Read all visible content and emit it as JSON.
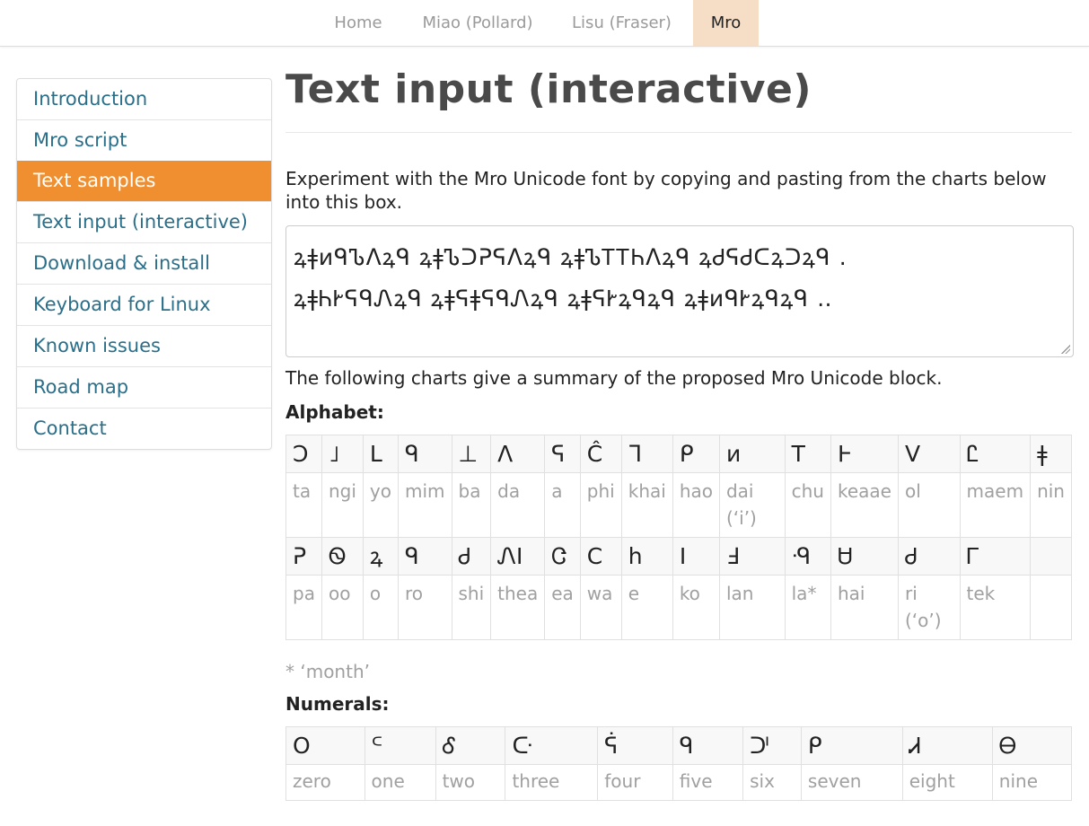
{
  "nav": {
    "tabs": [
      {
        "label": "Home"
      },
      {
        "label": "Miao (Pollard)"
      },
      {
        "label": "Lisu (Fraser)"
      },
      {
        "label": "Mro"
      }
    ],
    "active": "Mro",
    "active_color": "#f5dec5"
  },
  "sidebar": {
    "items": [
      {
        "label": "Introduction"
      },
      {
        "label": "Mro script"
      },
      {
        "label": "Text samples"
      },
      {
        "label": "Text input (interactive)"
      },
      {
        "label": "Download & install"
      },
      {
        "label": "Keyboard for Linux"
      },
      {
        "label": "Known issues"
      },
      {
        "label": "Road map"
      },
      {
        "label": "Contact"
      }
    ],
    "active": "Text samples",
    "active_color": "#ef8f30",
    "link_color": "#2a6f8a"
  },
  "main": {
    "title": "Text input (interactive)",
    "intro": "Experiment with the Mro Unicode font by copying and pasting from the charts below into this box.",
    "textbox_lines": [
      "ꝝǂᴎᑫᏖᐱꝝᑫ ꝝǂᏖᑐᕈᕋᐱꝝᑫ ꝝǂᏖᎢᎢᏂᐱꝝᑫ ꝝᏧᕋᏧᑕꝝᑐꝝᑫ ․",
      "ꝝǂᏂᎨᕋᑫᏁꝝᑫ ꝝǂᕋǂᕋᑫᏁꝝᑫ ꝝǂᕋᎨꝝᑫꝝᑫ ꝝǂᴎᑫᎨꝝᑫꝝᑫ ‥"
    ],
    "summary": "The following charts give a summary of the proposed Mro Unicode block.",
    "alphabet_label": "Alphabet:",
    "alphabet": [
      [
        {
          "g": "Ↄ",
          "n": "ta"
        },
        {
          "g": "˩",
          "n": "ngi"
        },
        {
          "g": "L",
          "n": "yo"
        },
        {
          "g": "ᑫ",
          "n": "mim"
        },
        {
          "g": "⊥",
          "n": "ba"
        },
        {
          "g": "Λ",
          "n": "da"
        },
        {
          "g": "ᕋ",
          "n": "a"
        },
        {
          "g": "Ĉ",
          "n": "phi"
        },
        {
          "g": "ᒣ",
          "n": "khai"
        },
        {
          "g": "ᑭ",
          "n": "hao"
        },
        {
          "g": "ᴎ",
          "n": "dai (‘i’)"
        },
        {
          "g": "T",
          "n": "chu"
        },
        {
          "g": "Ͱ",
          "n": "keaae"
        },
        {
          "g": "V",
          "n": "ol"
        },
        {
          "g": "Ꮭ",
          "n": "maem"
        },
        {
          "g": "ǂ",
          "n": "nin"
        }
      ],
      [
        {
          "g": "ᕈ",
          "n": "pa"
        },
        {
          "g": "Ꮻ",
          "n": "oo"
        },
        {
          "g": "ꝝ",
          "n": "o"
        },
        {
          "g": "ᑫ",
          "n": "ro"
        },
        {
          "g": "Ꮷ",
          "n": "shi"
        },
        {
          "g": "ᏁI",
          "n": "thea"
        },
        {
          "g": "Ꮳ",
          "n": "ea"
        },
        {
          "g": "C",
          "n": "wa"
        },
        {
          "g": "h",
          "n": "e"
        },
        {
          "g": "I",
          "n": "ko"
        },
        {
          "g": "Ⅎ",
          "n": "lan"
        },
        {
          "g": "ᑴ",
          "n": "la*"
        },
        {
          "g": "Ꮜ",
          "n": "hai"
        },
        {
          "g": "Ꮷ",
          "n": "ri (‘o’)"
        },
        {
          "g": "Ꮁ",
          "n": "tek"
        },
        {
          "g": "",
          "n": ""
        }
      ]
    ],
    "note": "* ‘month’",
    "numerals_label": "Numerals:",
    "numerals": [
      {
        "g": "O",
        "n": "zero"
      },
      {
        "g": "ᒼ",
        "n": "one"
      },
      {
        "g": "Ꮄ",
        "n": "two"
      },
      {
        "g": "ᑢ",
        "n": "three"
      },
      {
        "g": "ᕌ",
        "n": "four"
      },
      {
        "g": "ᑫ",
        "n": "five"
      },
      {
        "g": "ᑩ",
        "n": "six"
      },
      {
        "g": "ᑭ",
        "n": "seven"
      },
      {
        "g": "Ꮧ",
        "n": "eight"
      },
      {
        "g": "Ꮎ",
        "n": "nine"
      }
    ]
  }
}
